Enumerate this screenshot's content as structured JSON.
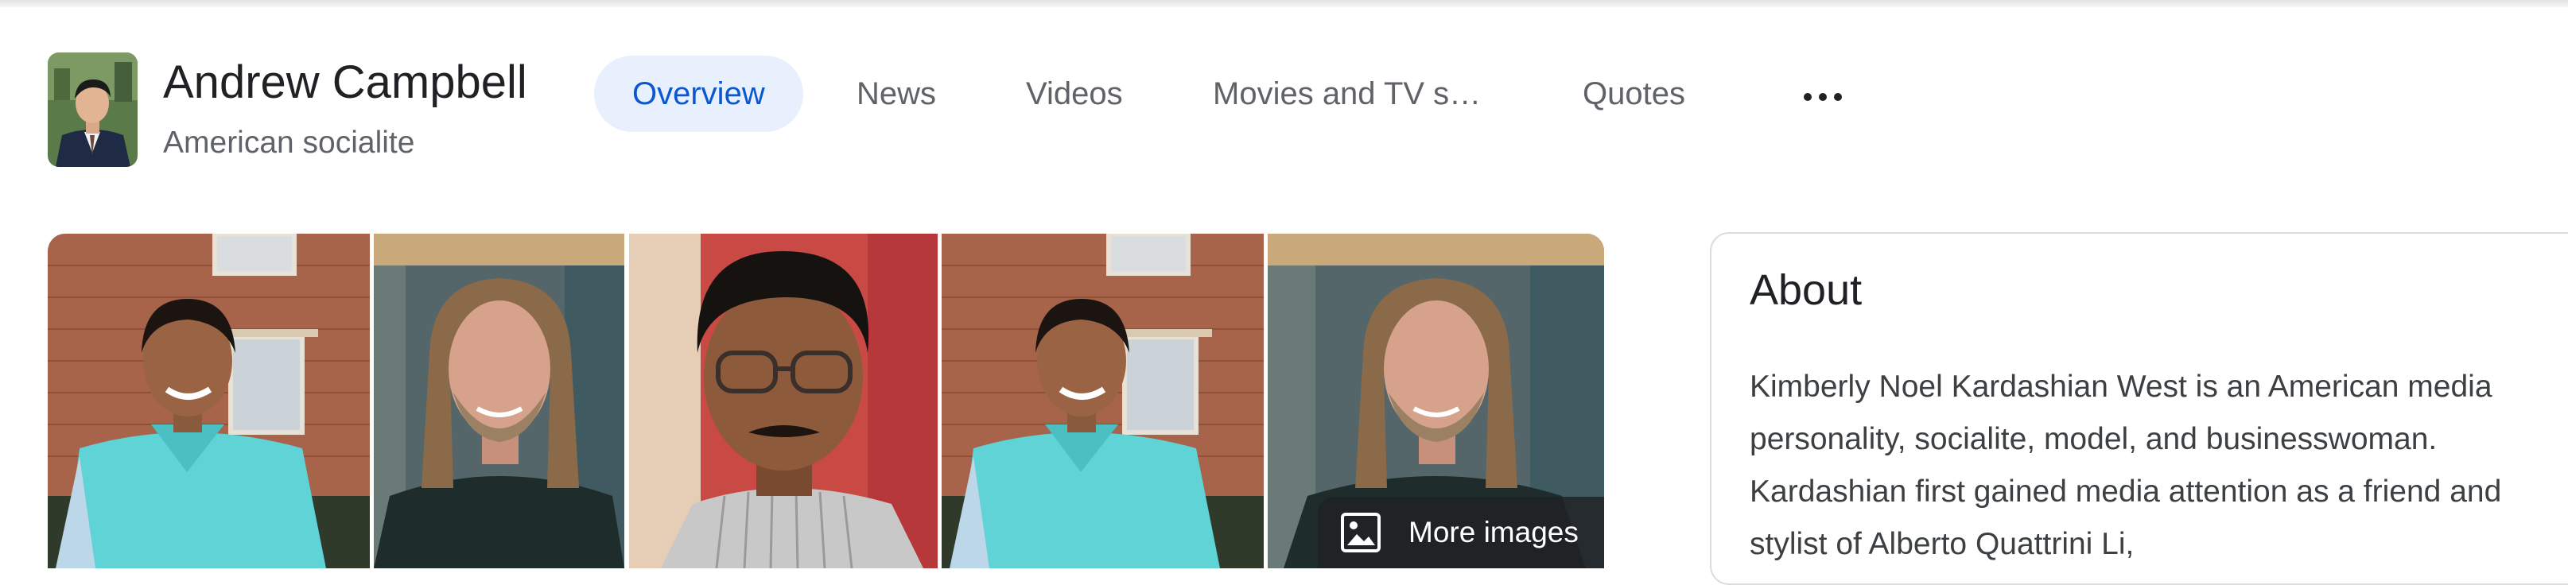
{
  "header": {
    "name": "Andrew Campbell",
    "subtitle": "American socialite"
  },
  "tabs": [
    {
      "label": "Overview",
      "active": true
    },
    {
      "label": "News"
    },
    {
      "label": "Videos"
    },
    {
      "label": "Movies and TV s…"
    },
    {
      "label": "Quotes"
    }
  ],
  "more_tab_icon": "more-horiz-icon",
  "images": {
    "more_label": "More images",
    "more_icon": "image-icon"
  },
  "about": {
    "title": "About",
    "text": "Kimberly Noel Kardashian West is an American media personality, socialite, model, and businesswoman. Kardashian first gained media attention as a friend and stylist of Alberto Quattrini Li,"
  },
  "colors": {
    "accent": "#0b57d0",
    "tab_active_bg": "#e8f0fe",
    "muted_text": "#5f6368"
  }
}
